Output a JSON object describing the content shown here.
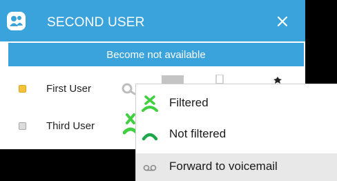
{
  "window": {
    "title": "SECOND USER",
    "close_glyph": "✕",
    "status_button_label": "Become not available"
  },
  "users": [
    {
      "name": "First User",
      "checkbox_color": "#f5c33b",
      "checked": true
    },
    {
      "name": "Third User",
      "checkbox_color": "#dcdcdc",
      "checked": false
    }
  ],
  "context_menu": {
    "items": [
      {
        "label": "Filtered",
        "icon": "call-filtered-icon",
        "icon_color": "#3fcf3f"
      },
      {
        "label": "Not filtered",
        "icon": "call-not-filtered-icon",
        "icon_color": "#1fa84a"
      },
      {
        "label": "Forward to voicemail",
        "icon": "voicemail-icon",
        "icon_color": "#8a8a8a",
        "highlighted": true
      }
    ]
  },
  "colors": {
    "accent": "#3aa3db",
    "background": "#000000"
  }
}
